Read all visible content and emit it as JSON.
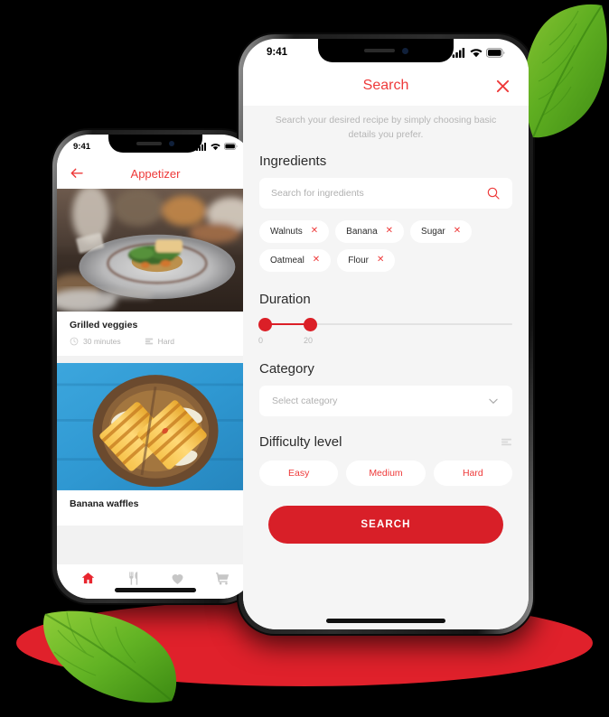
{
  "decor": {
    "platform_color": "#E0212B",
    "leaf_top_right": "leaf-icon",
    "leaf_bottom_left": "leaf-icon",
    "background_color": "#000000"
  },
  "theme": {
    "accent_red": "#EE3A3A",
    "button_red": "#D81F28",
    "slider_red": "#DB1F27",
    "screen_bg": "#F5F5F5"
  },
  "left_phone": {
    "status": {
      "time": "9:41",
      "icons": [
        "signal-icon",
        "wifi-icon",
        "battery-icon"
      ]
    },
    "header": {
      "back_icon": "back-arrow-icon",
      "title": "Appetizer"
    },
    "cards": [
      {
        "title": "Grilled veggies",
        "duration": "30 minutes",
        "difficulty": "Hard",
        "clock_icon": "clock-icon",
        "level_icon": "levels-icon",
        "image": "plated-gourmet-dish"
      },
      {
        "title": "Banana waffles",
        "image": "grilled-sandwich-blue-board"
      }
    ],
    "tabbar": [
      {
        "name": "home",
        "icon": "home-icon",
        "active": true
      },
      {
        "name": "recipes",
        "icon": "cutlery-icon",
        "active": false
      },
      {
        "name": "favorites",
        "icon": "heart-icon",
        "active": false
      },
      {
        "name": "cart",
        "icon": "cart-icon",
        "active": false
      }
    ]
  },
  "right_phone": {
    "status": {
      "time": "9:41",
      "icons": [
        "signal-icon",
        "wifi-icon",
        "battery-icon"
      ]
    },
    "header": {
      "title": "Search",
      "close_icon": "close-icon"
    },
    "subtitle": "Search your desired recipe by simply choosing basic details you prefer.",
    "ingredients": {
      "label": "Ingredients",
      "search_placeholder": "Search for ingredients",
      "search_value": "",
      "search_icon": "search-icon",
      "chips": [
        "Walnuts",
        "Banana",
        "Sugar",
        "Oatmeal",
        "Flour"
      ],
      "chip_remove_glyph": "✕"
    },
    "duration": {
      "label": "Duration",
      "min_label": "0",
      "max_label": "20",
      "min_value": 0,
      "max_value": 20,
      "range_end": 100
    },
    "category": {
      "label": "Category",
      "placeholder": "Select category",
      "value": "",
      "chevron_icon": "chevron-down-icon"
    },
    "difficulty": {
      "label": "Difficulty level",
      "levels_icon": "levels-icon",
      "options": [
        "Easy",
        "Medium",
        "Hard"
      ]
    },
    "submit_label": "SEARCH"
  }
}
